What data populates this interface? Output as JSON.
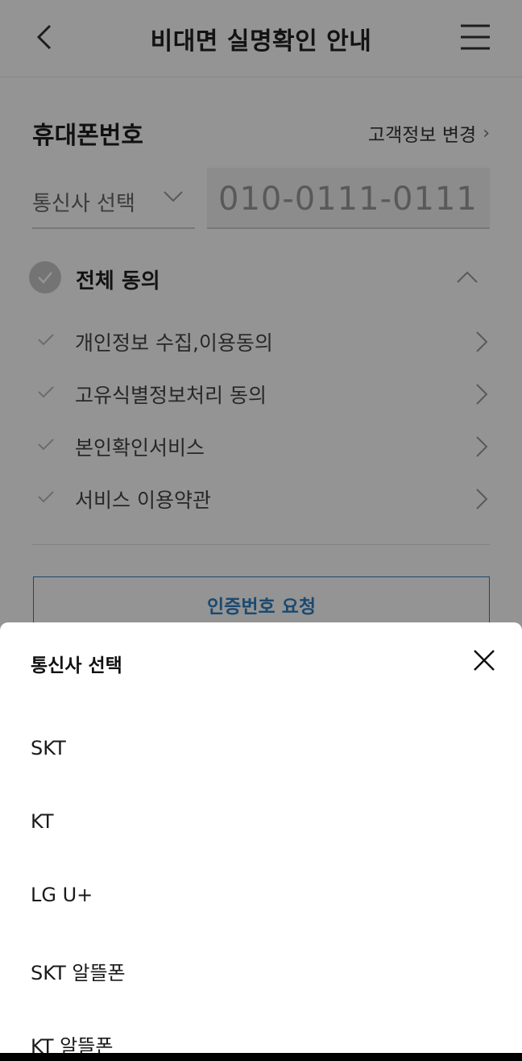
{
  "header": {
    "title": "비대면 실명확인 안내",
    "back_icon": "chevron-left-icon",
    "menu_icon": "hamburger-menu-icon"
  },
  "phone_section": {
    "title": "휴대폰번호",
    "change_link": "고객정보 변경",
    "carrier_select_label": "통신사 선택",
    "phone_value": "010-0111-0111"
  },
  "agreement": {
    "all_label": "전체 동의",
    "items": [
      {
        "label": "개인정보 수집,이용동의"
      },
      {
        "label": "고유식별정보처리 동의"
      },
      {
        "label": "본인확인서비스"
      },
      {
        "label": "서비스 이용약관"
      }
    ]
  },
  "request_button": "인증번호 요청",
  "sheet": {
    "title": "통신사 선택",
    "close_icon": "close-icon",
    "options": [
      {
        "label": "SKT"
      },
      {
        "label": "KT"
      },
      {
        "label": "LG U+"
      },
      {
        "label": "SKT 알뜰폰"
      },
      {
        "label": "KT 알뜰폰"
      }
    ]
  },
  "colors": {
    "accent": "#2f7fc1",
    "overlay": "rgba(0,0,0,0.42)",
    "check_circle": "#c8c8c8"
  }
}
